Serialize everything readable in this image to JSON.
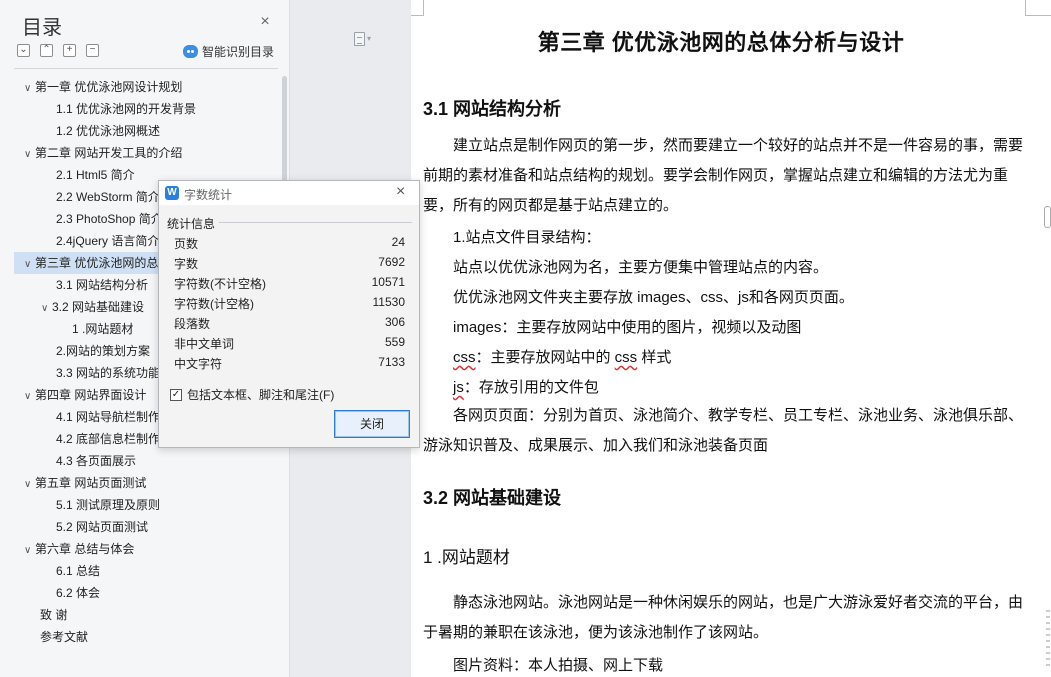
{
  "toc": {
    "title": "目录",
    "smart_label": "智能识别目录",
    "items": [
      {
        "label": "第一章  优优泳池网设计规划",
        "level": "l1",
        "caret": "∨"
      },
      {
        "label": "1.1  优优泳池网的开发背景",
        "level": "l2"
      },
      {
        "label": "1.2 优优泳池网概述",
        "level": "l2"
      },
      {
        "label": "第二章  网站开发工具的介绍",
        "level": "l1",
        "caret": "∨"
      },
      {
        "label": "2.1 Html5 简介",
        "level": "l2"
      },
      {
        "label": "2.2 WebStorm 简介",
        "level": "l2"
      },
      {
        "label": "2.3 PhotoShop 简介",
        "level": "l2"
      },
      {
        "label": "2.4jQuery 语言简介",
        "level": "l2"
      },
      {
        "label": "第三章  优优泳池网的总体分析与设计",
        "level": "l1",
        "caret": "∨",
        "selected": true
      },
      {
        "label": "3.1  网站结构分析",
        "level": "l2"
      },
      {
        "label": "3.2  网站基础建设",
        "level": "l2c",
        "caret": "∨"
      },
      {
        "label": "1 .网站题材",
        "level": "l3"
      },
      {
        "label": "2.网站的策划方案",
        "level": "l2"
      },
      {
        "label": "3.3 网站的系统功能",
        "level": "l2"
      },
      {
        "label": "第四章  网站界面设计",
        "level": "l1",
        "caret": "∨"
      },
      {
        "label": "4.1  网站导航栏制作",
        "level": "l2"
      },
      {
        "label": "4.2 底部信息栏制作",
        "level": "l2"
      },
      {
        "label": "4.3  各页面展示",
        "level": "l2"
      },
      {
        "label": "第五章  网站页面测试",
        "level": "l1",
        "caret": "∨"
      },
      {
        "label": "5.1 测试原理及原则",
        "level": "l2"
      },
      {
        "label": "5.2 网站页面测试",
        "level": "l2"
      },
      {
        "label": "第六章  总结与体会",
        "level": "l1",
        "caret": "∨"
      },
      {
        "label": "6.1  总结",
        "level": "l2"
      },
      {
        "label": "6.2 体会",
        "level": "l2"
      },
      {
        "label": "致  谢",
        "level": "l1-nocaret"
      },
      {
        "label": "参考文献",
        "level": "l1-nocaret"
      }
    ]
  },
  "dialog": {
    "title": "字数统计",
    "group": "统计信息",
    "stats": [
      {
        "k": "页数",
        "v": "24"
      },
      {
        "k": "字数",
        "v": "7692"
      },
      {
        "k": "字符数(不计空格)",
        "v": "10571"
      },
      {
        "k": "字符数(计空格)",
        "v": "11530"
      },
      {
        "k": "段落数",
        "v": "306"
      },
      {
        "k": "非中文单词",
        "v": "559"
      },
      {
        "k": "中文字符",
        "v": "7133"
      }
    ],
    "checkbox_label": "包括文本框、脚注和尾注(F)",
    "checkbox_checked": true,
    "close_label": "关闭"
  },
  "document": {
    "chapter_title": "第三章  优优泳池网的总体分析与设计",
    "s31_title": "3.1  网站结构分析",
    "p1": "建立站点是制作网页的第一步，然而要建立一个较好的站点并不是一件容易的事，需要前期的素材准备和站点结构的规划。要学会制作网页，掌握站点建立和编辑的方法尤为重要，所有的网页都是基于站点建立的。",
    "l1": "1.站点文件目录结构：",
    "l2": "站点以优优泳池网为名，主要方便集中管理站点的内容。",
    "l3": "优优泳池网文件夹主要存放 images、css、js和各网页页面。",
    "l4": "images：主要存放网站中使用的图片，视频以及动图",
    "l5_a": "css",
    "l5_b": "：主要存放网站中的 ",
    "l5_c": "css",
    "l5_d": " 样式",
    "l6_a": "js",
    "l6_b": "：存放引用的文件包",
    "p2": "各网页页面：分别为首页、泳池简介、教学专栏、员工专栏、泳池业务、泳池俱乐部、游泳知识普及、成果展示、加入我们和泳池装备页面",
    "s32_title": "3.2  网站基础建设",
    "s321_title": "1 .网站题材",
    "p3": "静态泳池网站。泳池网站是一种休闲娱乐的网站，也是广大游泳爱好者交流的平台，由于暑期的兼职在该泳池，便为该泳池制作了该网站。",
    "l7": "图片资料：本人拍摄、网上下载"
  }
}
